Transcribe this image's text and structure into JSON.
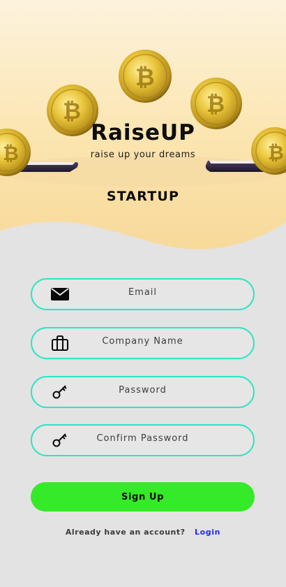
{
  "app": {
    "title": "RaiseUP",
    "tagline": "raise up your dreams",
    "role": "STARTUP"
  },
  "form": {
    "fields": [
      {
        "label": "Email",
        "icon": "mail-icon"
      },
      {
        "label": "Company Name",
        "icon": "briefcase-icon"
      },
      {
        "label": "Password",
        "icon": "key-icon"
      },
      {
        "label": "Confirm Password",
        "icon": "key-icon"
      }
    ],
    "submit_label": "Sign Up"
  },
  "footer": {
    "prompt": "Already have an account?",
    "login_label": "Login"
  },
  "colors": {
    "field_border": "#2ee4c2",
    "submit_bg": "#35ea28",
    "login_link": "#1f2cf0",
    "hero_bg": "#fbe6b3",
    "page_bg": "#e3e3e3"
  }
}
